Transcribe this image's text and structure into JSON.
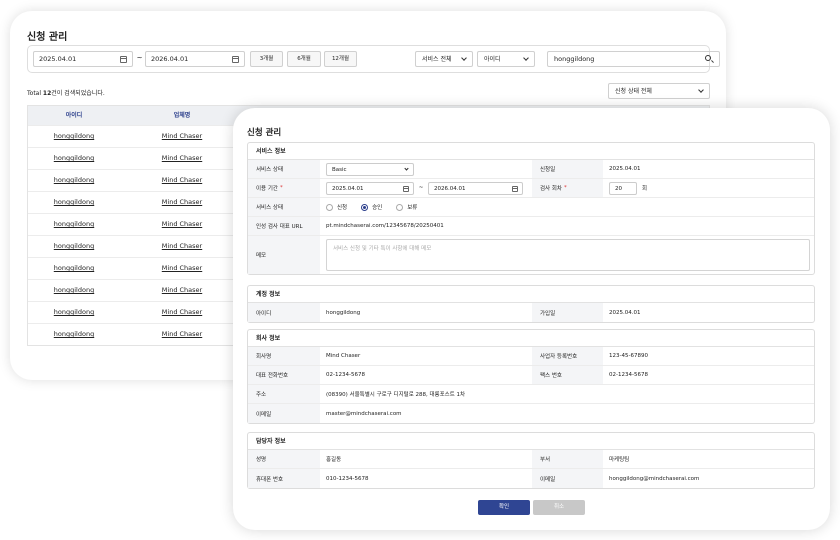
{
  "list": {
    "title": "신청 관리",
    "start_date": "2025.04.01",
    "tilde": "~",
    "end_date": "2026.04.01",
    "periods": [
      "3개월",
      "6개월",
      "12개월"
    ],
    "service_filter": "서비스 전체",
    "search_type": "아이디",
    "search_value": "honggildong",
    "total_prefix": "Total ",
    "total_count": "12",
    "total_suffix": "건이 검색되었습니다.",
    "status_filter": "신청 상태 전체",
    "columns": [
      "아이디",
      "업체명"
    ],
    "rows": [
      {
        "id": "honggildong",
        "company": "Mind Chaser"
      },
      {
        "id": "honggildong",
        "company": "Mind Chaser"
      },
      {
        "id": "honggildong",
        "company": "Mind Chaser"
      },
      {
        "id": "honggildong",
        "company": "Mind Chaser"
      },
      {
        "id": "honggildong",
        "company": "Mind Chaser"
      },
      {
        "id": "honggildong",
        "company": "Mind Chaser"
      },
      {
        "id": "honggildong",
        "company": "Mind Chaser"
      },
      {
        "id": "honggildong",
        "company": "Mind Chaser"
      },
      {
        "id": "honggildong",
        "company": "Mind Chaser"
      },
      {
        "id": "honggildong",
        "company": "Mind Chaser"
      }
    ]
  },
  "modal": {
    "title": "신청 관리",
    "service": {
      "title": "서비스 정보",
      "status_label": "서비스 상태",
      "status_value": "Basic",
      "apply_date_label": "신청일",
      "apply_date": "2025.04.01",
      "period_label": "이용 기간",
      "required_mark": "*",
      "period_start": "2025.04.01",
      "tilde": "~",
      "period_end": "2026.04.01",
      "test_count_label": "검사 회차",
      "test_count": "20",
      "test_count_unit": "회",
      "service_state_label": "서비스 상태",
      "radio_options": [
        "신청",
        "승인",
        "보류"
      ],
      "radio_selected_index": 1,
      "url_label": "인성 검사 대표 URL",
      "url_value": "pt.mindchaserai.com/12345678/20250401",
      "memo_label": "메모",
      "memo_placeholder": "서비스 신청 및 기타 특이 사항에 대해 메모"
    },
    "account": {
      "title": "계정 정보",
      "id_label": "아이디",
      "id_value": "honggildong",
      "join_label": "가입일",
      "join_value": "2025.04.01"
    },
    "company": {
      "title": "회사 정보",
      "name_label": "회사명",
      "name_value": "Mind Chaser",
      "biz_label": "사업자 등록번호",
      "biz_value": "123-45-67890",
      "phone_label": "대표 전화번호",
      "phone_value": "02-1234-5678",
      "fax_label": "팩스 번호",
      "fax_value": "02-1234-5678",
      "addr_label": "주소",
      "addr_value": "(08390) 서울특별시 구로구 디지털로 288, 대륭포스트 1차",
      "email_label": "이메일",
      "email_value": "master@mindchaserai.com"
    },
    "manager": {
      "title": "담당자 정보",
      "name_label": "성명",
      "name_value": "홍길동",
      "dept_label": "부서",
      "dept_value": "마케팅팀",
      "mobile_label": "휴대폰 번호",
      "mobile_value": "010-1234-5678",
      "email_label": "이메일",
      "email_value": "honggildong@mindchaserai.com"
    },
    "confirm_label": "확인",
    "cancel_label": "취소"
  }
}
